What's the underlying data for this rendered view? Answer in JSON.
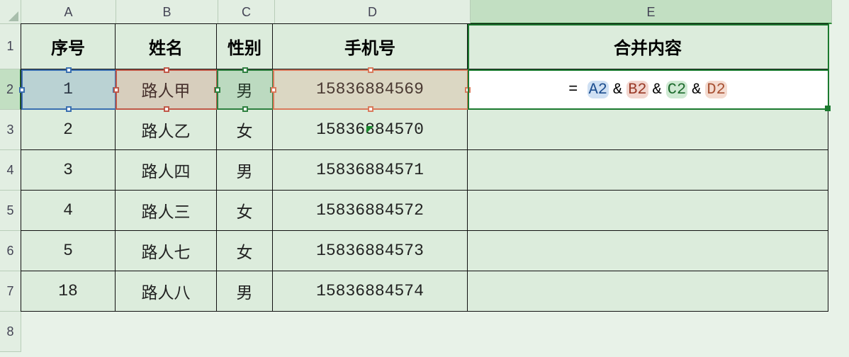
{
  "columns": [
    "A",
    "B",
    "C",
    "D",
    "E"
  ],
  "row_labels": [
    "1",
    "2",
    "3",
    "4",
    "5",
    "6",
    "7",
    "8"
  ],
  "headers": {
    "A": "序号",
    "B": "姓名",
    "C": "性别",
    "D": "手机号",
    "E": "合并内容"
  },
  "rows": [
    {
      "A": "1",
      "B": "路人甲",
      "C": "男",
      "D": "15836884569",
      "E": ""
    },
    {
      "A": "2",
      "B": "路人乙",
      "C": "女",
      "D": "15836884570",
      "E": ""
    },
    {
      "A": "3",
      "B": "路人四",
      "C": "男",
      "D": "15836884571",
      "E": ""
    },
    {
      "A": "4",
      "B": "路人三",
      "C": "女",
      "D": "15836884572",
      "E": ""
    },
    {
      "A": "5",
      "B": "路人七",
      "C": "女",
      "D": "15836884573",
      "E": ""
    },
    {
      "A": "18",
      "B": "路人八",
      "C": "男",
      "D": "15836884574",
      "E": ""
    }
  ],
  "formula": {
    "raw": "=A2&B2&C2&D2",
    "eq": "=",
    "amp": "&",
    "refs": [
      "A2",
      "B2",
      "C2",
      "D2"
    ],
    "ref_colors": [
      "blue",
      "red",
      "green",
      "sal"
    ]
  },
  "active_cell": "E2"
}
